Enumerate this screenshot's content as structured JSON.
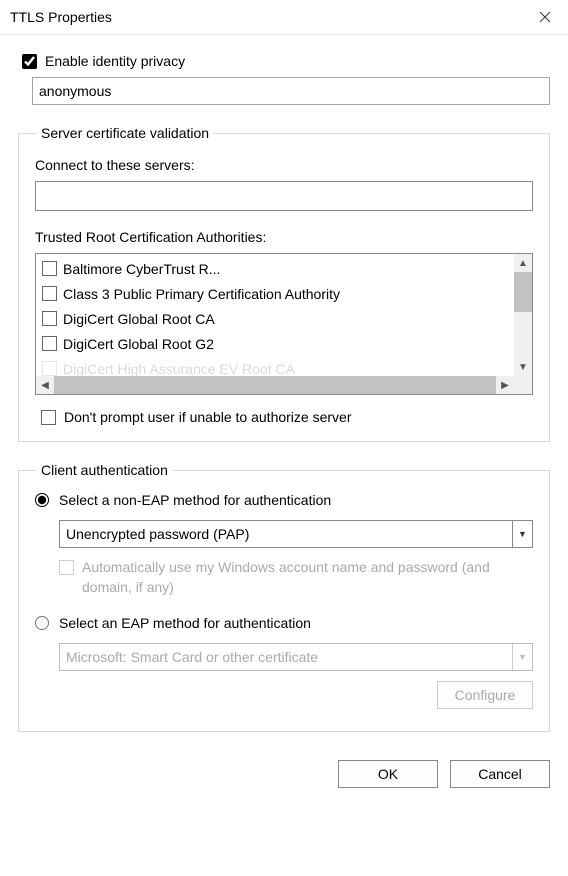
{
  "title": "TTLS Properties",
  "identity_privacy": {
    "label": "Enable identity privacy",
    "checked": true,
    "value": "anonymous"
  },
  "server_validation": {
    "legend": "Server certificate validation",
    "connect_label": "Connect to these servers:",
    "connect_value": "",
    "ca_label": "Trusted Root Certification Authorities:",
    "ca_list": [
      {
        "label": "Baltimore CyberTrust R...",
        "checked": false
      },
      {
        "label": "Class 3 Public Primary Certification Authority",
        "checked": false
      },
      {
        "label": "DigiCert Global Root CA",
        "checked": false
      },
      {
        "label": "DigiCert Global Root G2",
        "checked": false
      },
      {
        "label": "DigiCert High Assurance EV Root CA",
        "checked": false
      }
    ],
    "dont_prompt_label": "Don't prompt user if unable to authorize server",
    "dont_prompt_checked": false
  },
  "client_auth": {
    "legend": "Client authentication",
    "non_eap_label": "Select a non-EAP method for authentication",
    "non_eap_selected": true,
    "non_eap_option": "Unencrypted password (PAP)",
    "auto_windows_label": "Automatically use my Windows account name and password (and domain, if any)",
    "eap_label": "Select an EAP method for authentication",
    "eap_selected": false,
    "eap_option": "Microsoft: Smart Card or other certificate",
    "configure_label": "Configure"
  },
  "buttons": {
    "ok": "OK",
    "cancel": "Cancel"
  }
}
